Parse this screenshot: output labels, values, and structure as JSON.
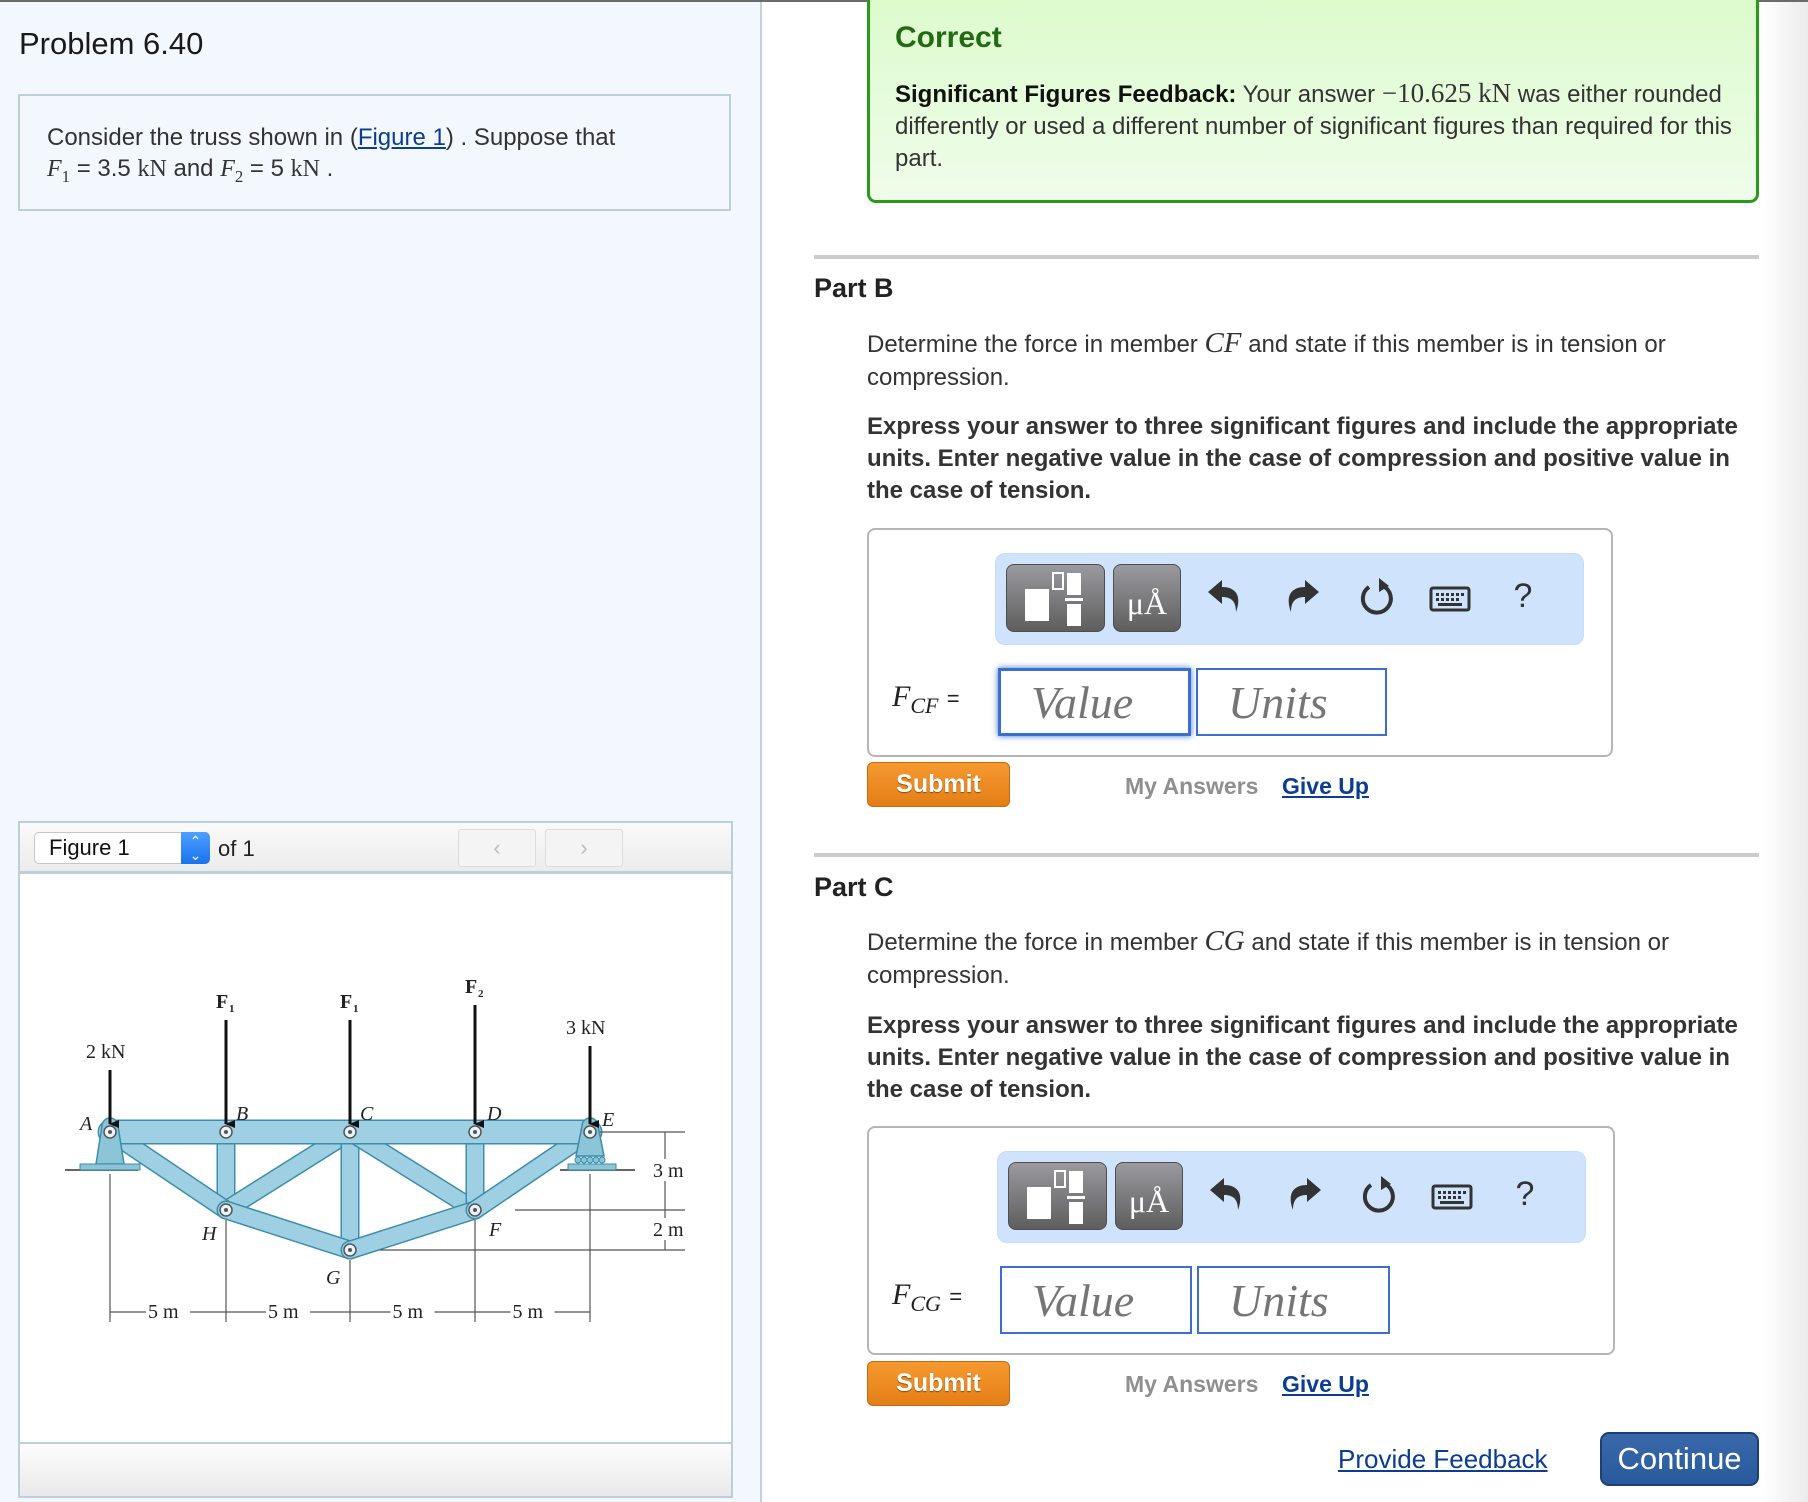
{
  "problem": {
    "title": "Problem 6.40",
    "statement_prefix": "Consider the truss shown in (",
    "figure_link": "Figure 1",
    "statement_suffix": ") . Suppose that",
    "f1_symbol": "F",
    "f1_sub": "1",
    "f1_value": " = 3.5 ",
    "f1_unit": "kN",
    "and": " and ",
    "f2_symbol": "F",
    "f2_sub": "2",
    "f2_value": " = 5 ",
    "f2_unit": "kN",
    "end": " ."
  },
  "figure_viewer": {
    "selected": "Figure 1",
    "of_label": "of 1",
    "prev_icon": "‹",
    "next_icon": "›"
  },
  "truss": {
    "loads": {
      "A": "2 kN",
      "B": "F1",
      "C": "F1",
      "D": "F2",
      "E": "3 kN"
    },
    "load_labels": {
      "A_main": "2 kN",
      "B_main": "F",
      "B_sub": "1",
      "C_main": "F",
      "C_sub": "1",
      "D_main": "F",
      "D_sub": "2",
      "E_main": "3 kN"
    },
    "joints": {
      "A": "A",
      "B": "B",
      "C": "C",
      "D": "D",
      "E": "E",
      "F": "F",
      "G": "G",
      "H": "H"
    },
    "dimensions": {
      "span1": "5 m",
      "span2": "5 m",
      "span3": "5 m",
      "span4": "5 m",
      "height1": "3 m",
      "height2": "2 m"
    },
    "colors": {
      "member": "#9fcfe2",
      "member_edge": "#3b8ea8",
      "support": "#8cc4d8"
    }
  },
  "feedback": {
    "title": "Correct",
    "label": "Significant Figures Feedback:",
    "text_before": " Your answer ",
    "answer": "−10.625 kN",
    "text_after": " was either rounded differently or used a different number of significant figures than required for this part."
  },
  "parts": [
    {
      "label": "Part B",
      "question_prefix": "Determine the force in member ",
      "member": "CF",
      "question_suffix": " and state if this member is in tension or compression.",
      "instructions": "Express your answer to three significant figures and include the appropriate units. Enter negative value in the case of compression and positive value in the case of tension.",
      "answer_symbol": "F",
      "answer_sub": "CF",
      "equals": "=",
      "value_placeholder": "Value",
      "units_placeholder": "Units",
      "submit": "Submit",
      "my_answers": "My Answers",
      "give_up": "Give Up"
    },
    {
      "label": "Part C",
      "question_prefix": "Determine the force in member ",
      "member": "CG",
      "question_suffix": " and state if this member is in tension or compression.",
      "instructions": "Express your answer to three significant figures and include the appropriate units. Enter negative value in the case of compression and positive value in the case of tension.",
      "answer_symbol": "F",
      "answer_sub": "CG",
      "equals": "=",
      "value_placeholder": "Value",
      "units_placeholder": "Units",
      "submit": "Submit",
      "my_answers": "My Answers",
      "give_up": "Give Up"
    }
  ],
  "toolbar": {
    "templates_icon": "fraction-template-icon",
    "units_label": "μÅ",
    "undo_icon": "undo-icon",
    "redo_icon": "redo-icon",
    "reset_icon": "reset-icon",
    "keyboard_icon": "keyboard-icon",
    "help_label": "?"
  },
  "footer": {
    "provide_feedback": "Provide Feedback",
    "continue": "Continue"
  }
}
